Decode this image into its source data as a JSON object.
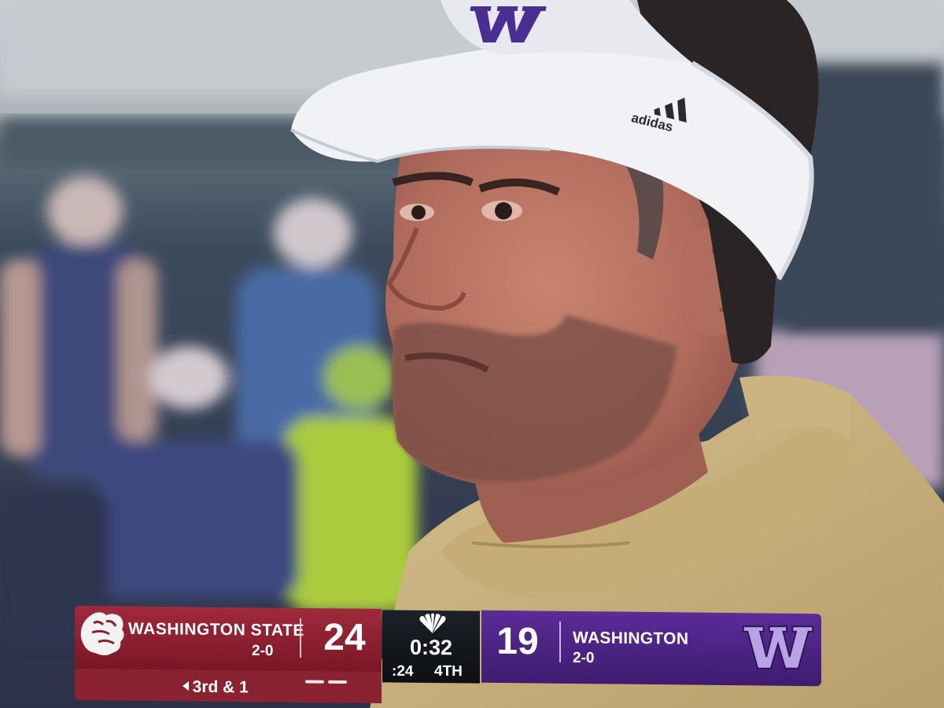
{
  "scorebug": {
    "away": {
      "team": "WASHINGTON STATE",
      "record": "2-0",
      "score": "24",
      "color": "#8a1f30"
    },
    "home": {
      "team": "WASHINGTON",
      "record": "2-0",
      "score": "19",
      "color": "#4b2587"
    },
    "clock": "0:32",
    "play_clock": ":24",
    "quarter": "4TH",
    "down_distance": "3rd & 1",
    "network_icon": "peacock-icon"
  },
  "apparel": {
    "visor_logo": "W",
    "visor_brand": "adidas"
  }
}
